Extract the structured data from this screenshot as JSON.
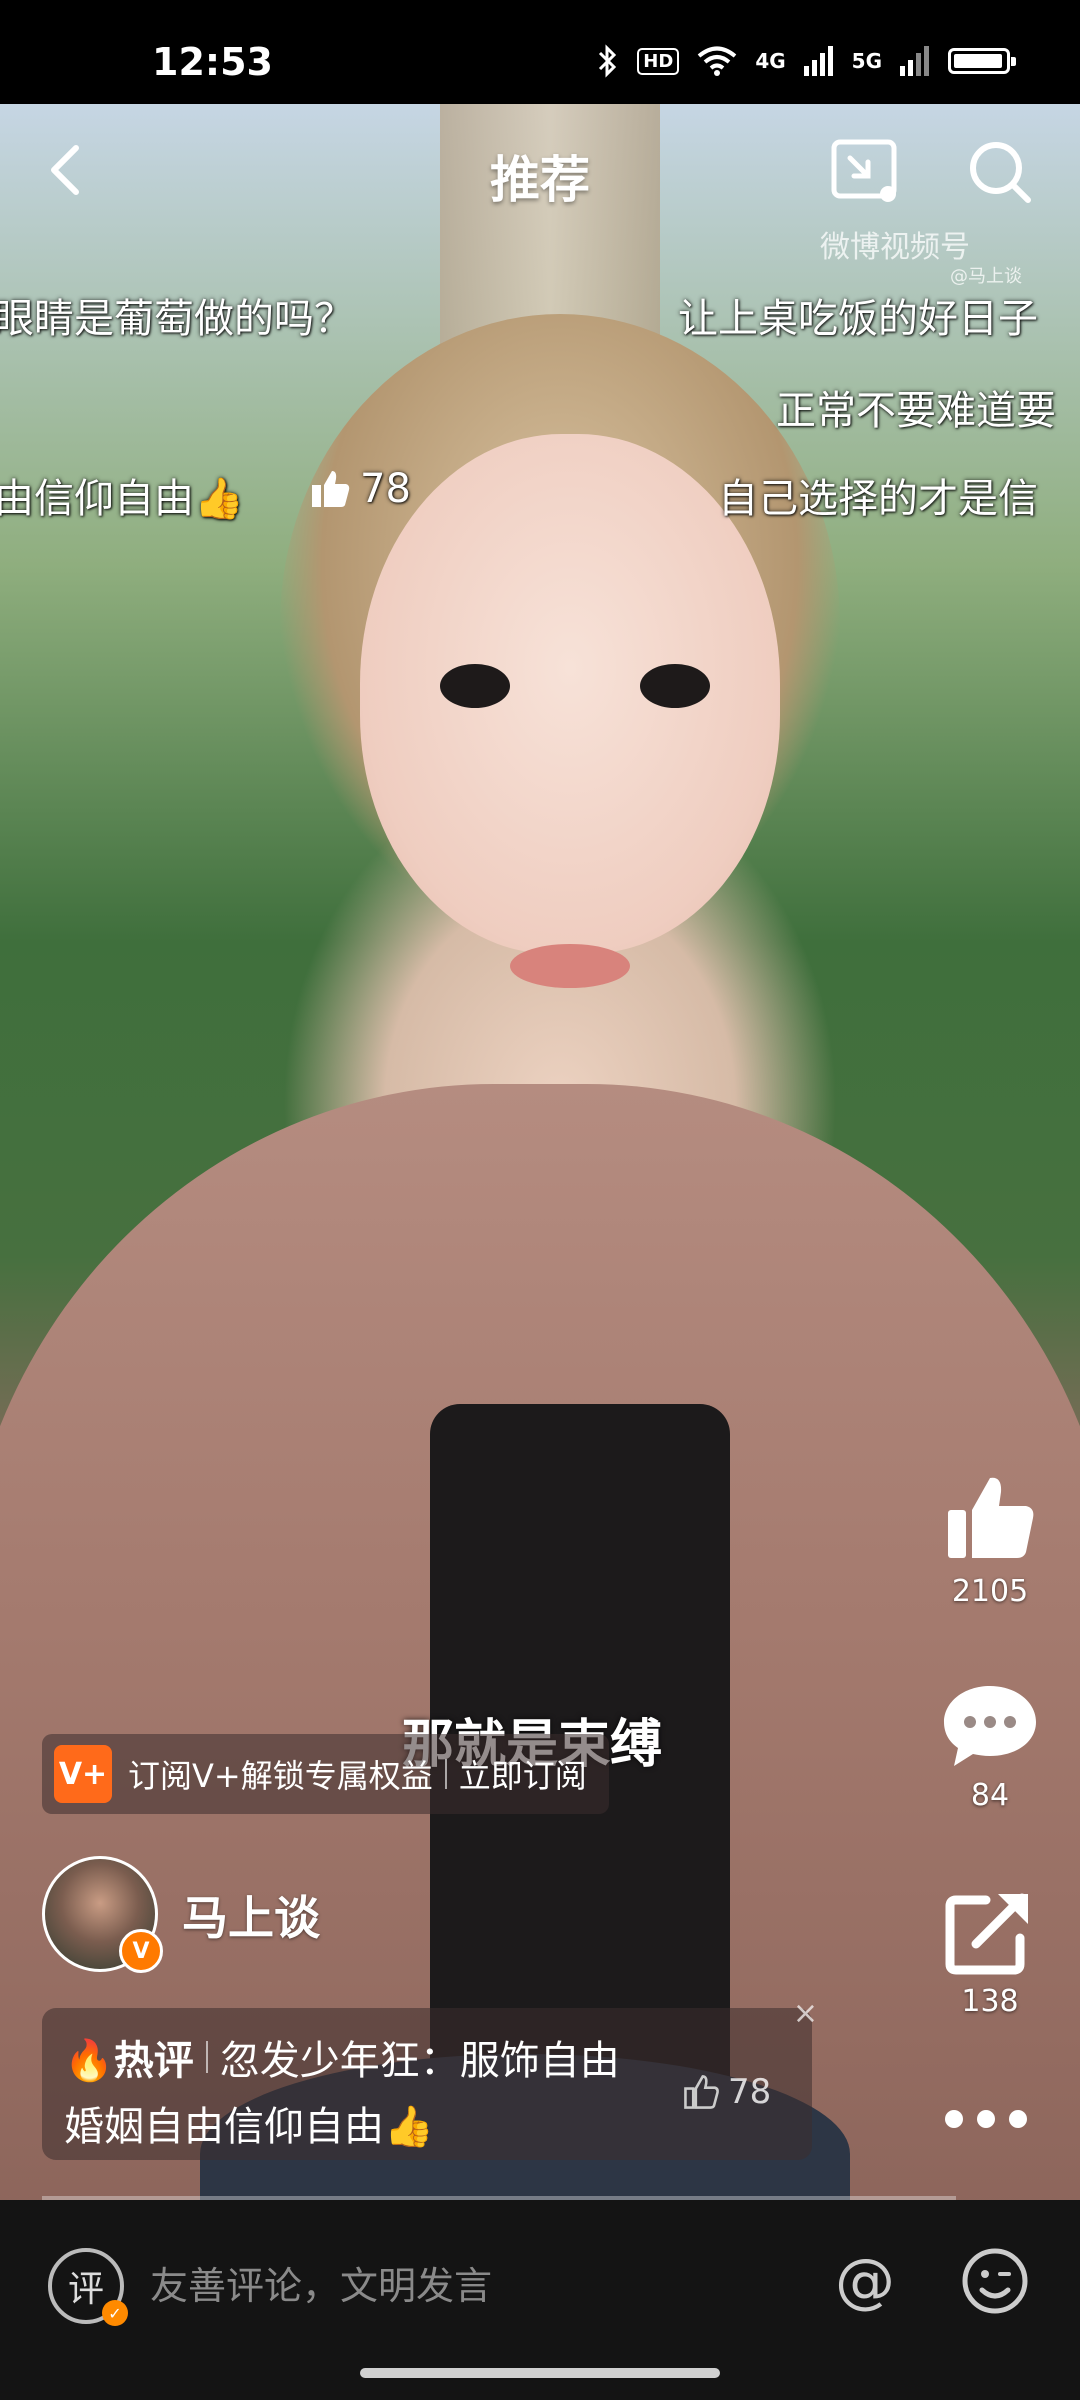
{
  "status_bar": {
    "time": "12:53",
    "hd_label": "HD",
    "net1": "4G",
    "net2": "5G",
    "battery_level": 0.95
  },
  "nav": {
    "title": "推荐"
  },
  "watermark": {
    "main": "微博视频号",
    "sub": "@马上谈"
  },
  "danmaku": [
    "眼睛是葡萄做的吗？",
    "让上桌吃饭的好日子",
    "正常不要难道要",
    "由信仰自由👍",
    "78",
    "自己选择的才是信"
  ],
  "subtitle": "那就是束缚",
  "actions": {
    "like_count": "2105",
    "comment_count": "84",
    "share_count": "138"
  },
  "subscribe_banner": {
    "badge": "V+",
    "text": "订阅V+解锁专属权益",
    "cta": "立即订阅"
  },
  "author": {
    "name": "马上谈",
    "badge": "V"
  },
  "hot_comment": {
    "tag": "🔥热评",
    "user": "忽发少年狂",
    "line1_text": "：服饰自由",
    "line2_text": "婚姻自由信仰自由👍",
    "likes": "78",
    "close": "×"
  },
  "bottom_bar": {
    "comment_icon_text": "评",
    "placeholder": "友善评论，文明发言",
    "mention": "@"
  },
  "colors": {
    "accent": "#ff6a1a",
    "background": "#141414"
  }
}
